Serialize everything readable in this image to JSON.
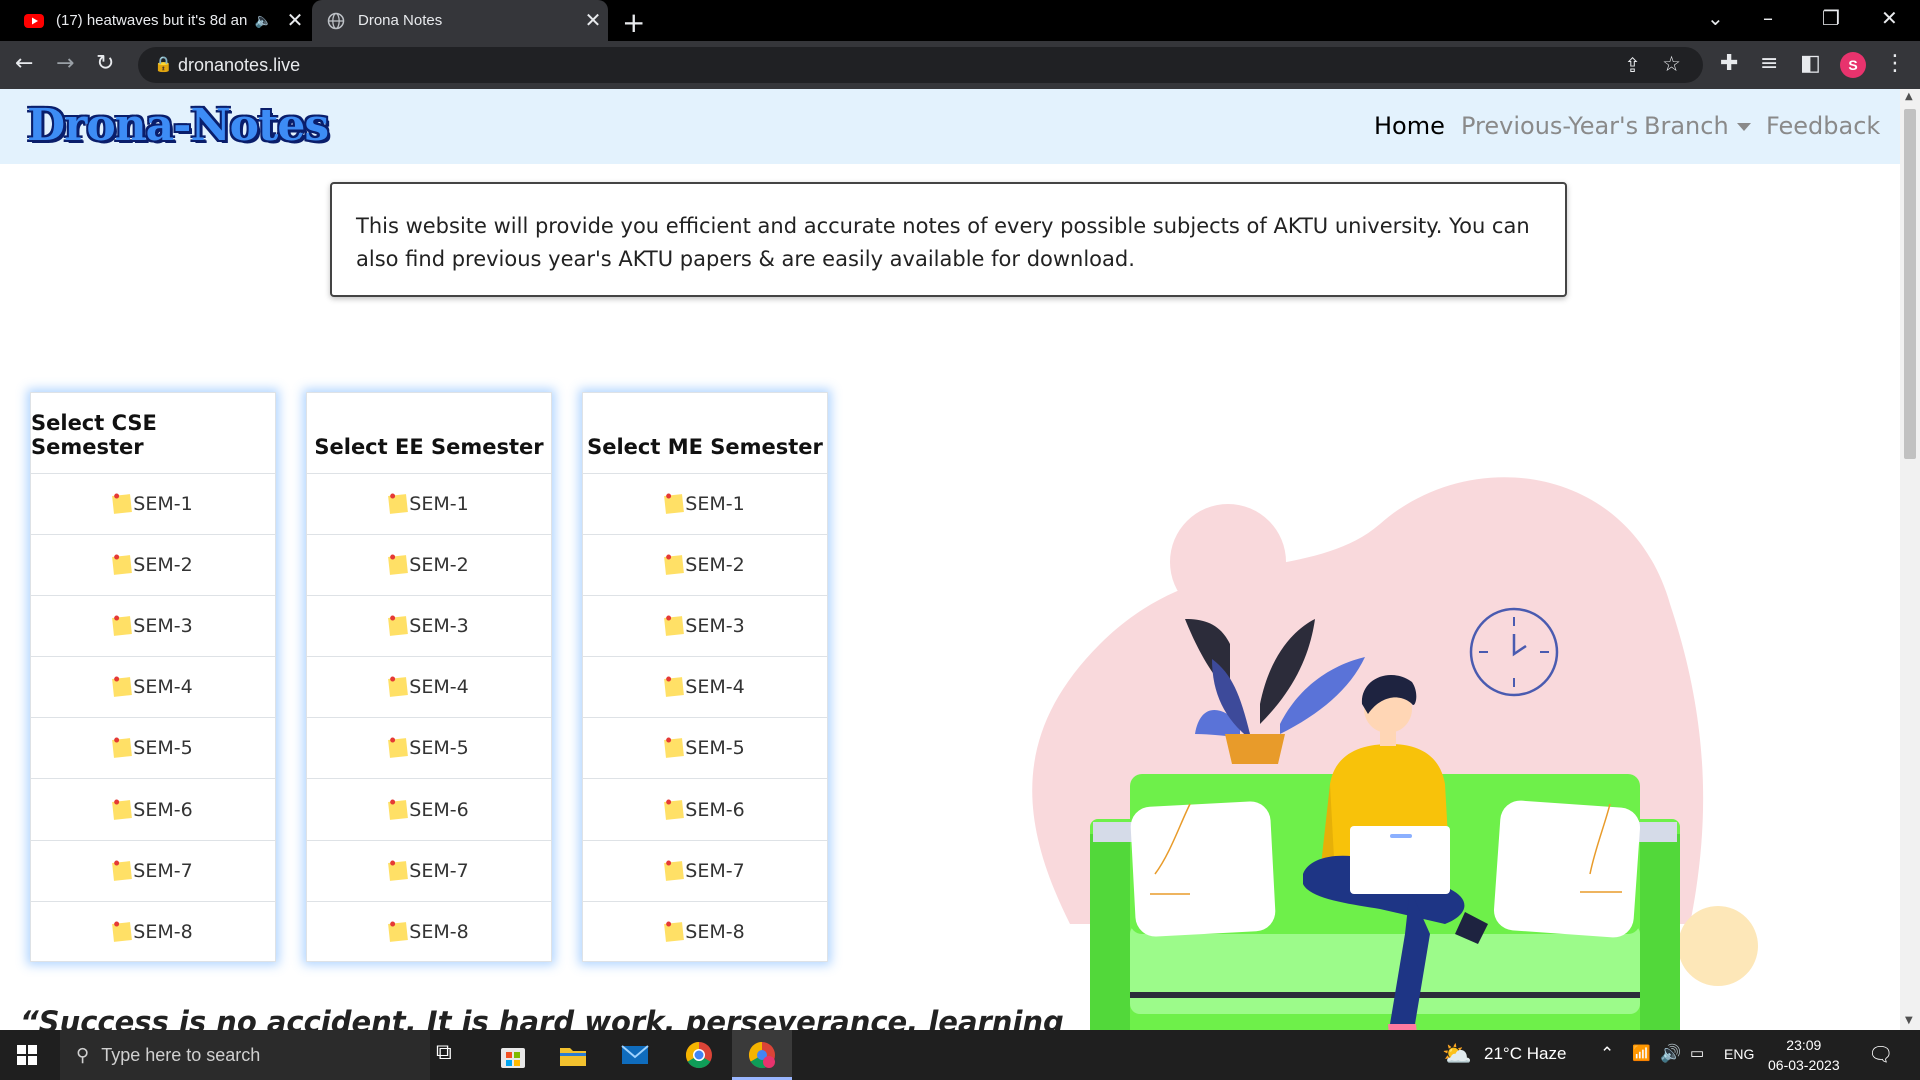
{
  "browser": {
    "tabs": [
      {
        "title": "(17) heatwaves but it's 8d an",
        "active": false
      },
      {
        "title": "Drona Notes",
        "active": true
      }
    ],
    "url": "dronanotes.live",
    "profile_initial": "S"
  },
  "site": {
    "brand": "Drona-Notes",
    "nav": {
      "home": "Home",
      "previous": "Previous-Year's",
      "branch": "Branch",
      "feedback": "Feedback"
    },
    "info_text": "This website will provide you efficient and accurate notes of every possible subjects of AKTU university. You can also find previous year's AKTU papers & are easily available for download.",
    "cards": [
      {
        "title": "Select CSE Semester",
        "items": [
          "SEM-1",
          "SEM-2",
          "SEM-3",
          "SEM-4",
          "SEM-5",
          "SEM-6",
          "SEM-7",
          "SEM-8"
        ]
      },
      {
        "title": "Select EE Semester",
        "items": [
          "SEM-1",
          "SEM-2",
          "SEM-3",
          "SEM-4",
          "SEM-5",
          "SEM-6",
          "SEM-7",
          "SEM-8"
        ]
      },
      {
        "title": "Select ME Semester",
        "items": [
          "SEM-1",
          "SEM-2",
          "SEM-3",
          "SEM-4",
          "SEM-5",
          "SEM-6",
          "SEM-7",
          "SEM-8"
        ]
      }
    ],
    "quote": "“Success is no accident. It is hard work, perseverance, learning"
  },
  "taskbar": {
    "search_placeholder": "Type here to search",
    "weather": "21°C  Haze",
    "lang": "ENG",
    "time": "23:09",
    "date": "06-03-2023"
  },
  "colors": {
    "navbar_bg": "#e3f2fd",
    "brand_fill": "#3d8cf5",
    "card_glow": "#50a0ff",
    "sofa_green": "#6ef04a"
  }
}
